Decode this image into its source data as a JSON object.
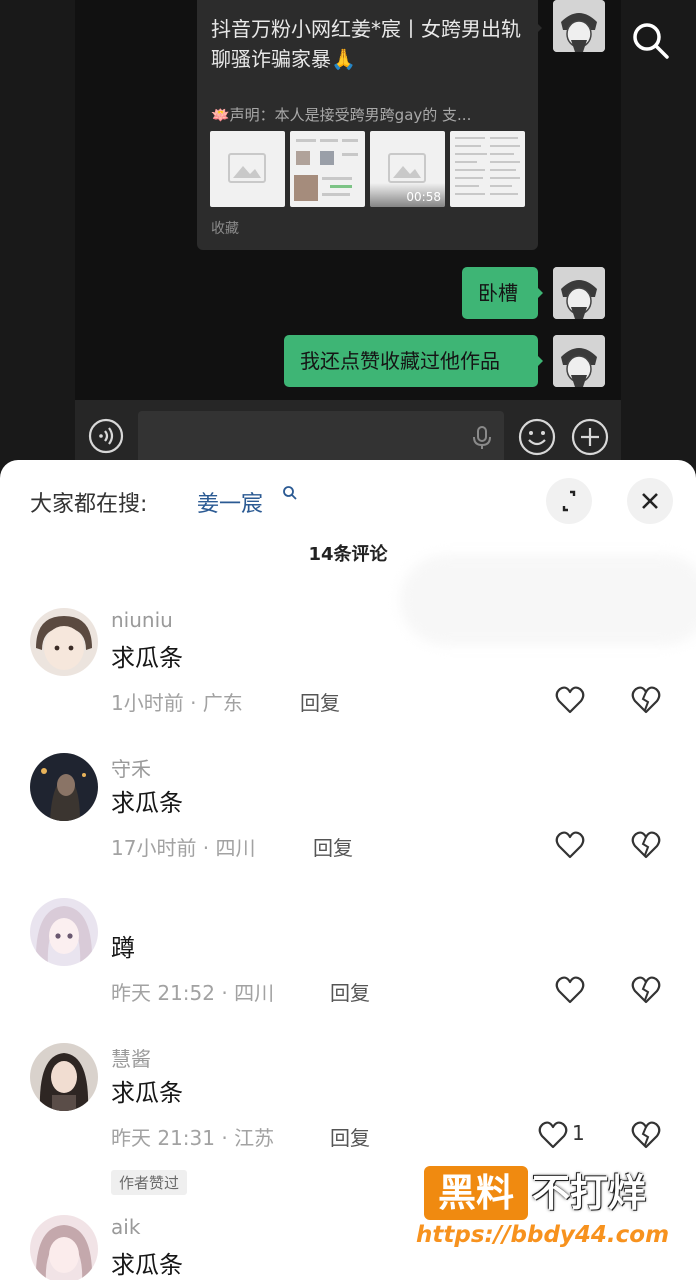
{
  "chat": {
    "favorite_card": {
      "title": "抖音万粉小网红姜*宸丨女跨男出轨聊骚诈骗家暴🙏",
      "desc": "🪷声明：本人是接受跨男跨gay的 支...",
      "video_duration": "00:58",
      "source_label": "收藏"
    },
    "messages": [
      {
        "text": "卧槽"
      },
      {
        "text": "我还点赞收藏过他作品"
      }
    ],
    "icons": {
      "search": "search-icon",
      "voice": "voice-icon",
      "mic": "mic-icon",
      "emoji": "emoji-icon",
      "plus": "plus-icon"
    }
  },
  "sheet": {
    "search_prefix": "大家都在搜:",
    "search_term": "姜一宸",
    "comment_count": "14条评论",
    "reply_label": "回复",
    "author_liked_badge": "作者赞过",
    "comments": [
      {
        "user": "niuniu",
        "text": "求瓜条",
        "time_loc": "1小时前 · 广东",
        "likes": ""
      },
      {
        "user": "守禾",
        "text": "求瓜条",
        "time_loc": "17小时前 · 四川",
        "likes": ""
      },
      {
        "user": "",
        "text": "蹲",
        "time_loc": "昨天 21:52 · 四川",
        "likes": ""
      },
      {
        "user": "慧酱",
        "text": "求瓜条",
        "time_loc": "昨天 21:31 · 江苏",
        "likes": "1"
      },
      {
        "user": "aik",
        "text": "求瓜条",
        "time_loc": "",
        "likes": ""
      }
    ]
  },
  "watermark": {
    "badge": "黑料",
    "text": "不打烊",
    "url": "https://bbdy44.com"
  },
  "colors": {
    "chat_bg": "#111111",
    "bubble_green": "#3eb575",
    "link_blue": "#2b5a93",
    "watermark_orange": "#f08a10"
  }
}
